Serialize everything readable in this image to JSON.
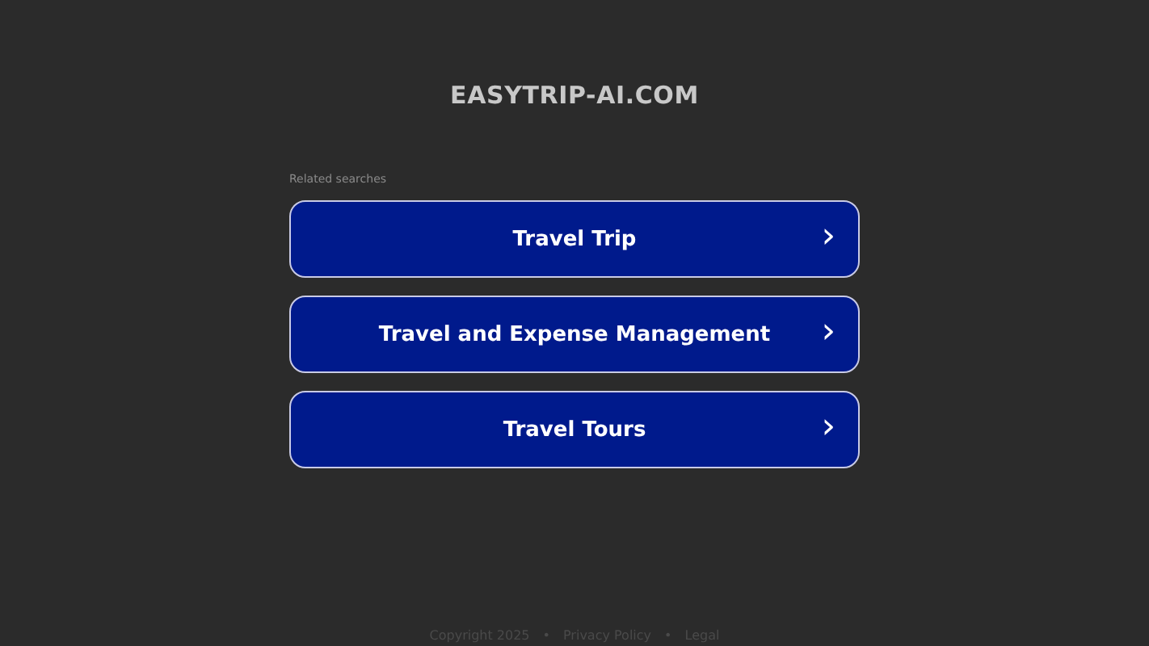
{
  "header": {
    "domain": "EASYTRIP-AI.COM"
  },
  "related": {
    "heading": "Related searches",
    "links": [
      {
        "label": "Travel Trip",
        "arrow": "›"
      },
      {
        "label": "Travel and Expense Management",
        "arrow": "›"
      },
      {
        "label": "Travel Tours",
        "arrow": "›"
      }
    ]
  },
  "footer": {
    "copyright": "Copyright 2025",
    "links": [
      "Privacy Policy",
      "Legal"
    ],
    "separator": "•"
  }
}
